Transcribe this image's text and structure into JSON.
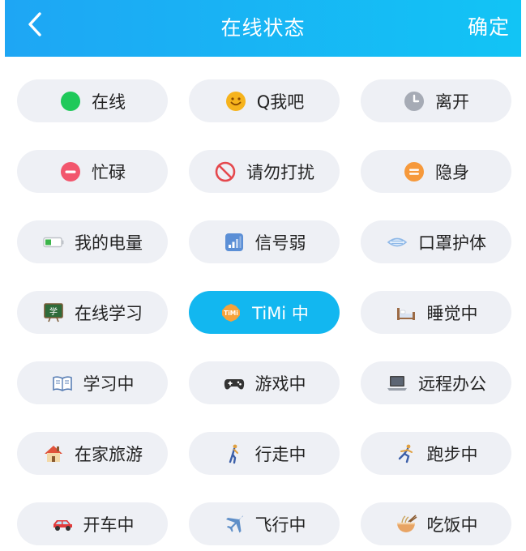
{
  "header": {
    "title": "在线状态",
    "confirm_label": "确定"
  },
  "statuses": [
    {
      "label": "在线",
      "icon": "online-dot-icon",
      "color": "#1fc95a"
    },
    {
      "label": "Q我吧",
      "icon": "smile-face-icon",
      "color": "#f6b31c"
    },
    {
      "label": "离开",
      "icon": "clock-icon",
      "color": "#a6abb5"
    },
    {
      "label": "忙碌",
      "icon": "busy-minus-icon",
      "color": "#f2566d"
    },
    {
      "label": "请勿打扰",
      "icon": "no-entry-icon",
      "color": "#e5484d"
    },
    {
      "label": "隐身",
      "icon": "invisible-icon",
      "color": "#f6993b"
    },
    {
      "label": "我的电量",
      "icon": "battery-icon",
      "color": "#3bb44a"
    },
    {
      "label": "信号弱",
      "icon": "signal-icon",
      "color": "#5b8fd6"
    },
    {
      "label": "口罩护体",
      "icon": "mask-icon",
      "color": "#8fb9e8"
    },
    {
      "label": "在线学习",
      "icon": "blackboard-icon",
      "color": "#2e6b3a"
    },
    {
      "label": "TiMi 中",
      "icon": "timi-icon",
      "color": "#f6a23a",
      "selected": true
    },
    {
      "label": "睡觉中",
      "icon": "bed-icon",
      "color": "#9c6b45"
    },
    {
      "label": "学习中",
      "icon": "book-icon",
      "color": "#5a7fb5"
    },
    {
      "label": "游戏中",
      "icon": "gamepad-icon",
      "color": "#333333"
    },
    {
      "label": "远程办公",
      "icon": "laptop-icon",
      "color": "#444444"
    },
    {
      "label": "在家旅游",
      "icon": "house-icon",
      "color": "#e0533b"
    },
    {
      "label": "行走中",
      "icon": "walking-icon",
      "color": "#e0a040"
    },
    {
      "label": "跑步中",
      "icon": "running-icon",
      "color": "#e0a040"
    },
    {
      "label": "开车中",
      "icon": "car-icon",
      "color": "#e23b3b"
    },
    {
      "label": "飞行中",
      "icon": "airplane-icon",
      "color": "#5f8fc8"
    },
    {
      "label": "吃饭中",
      "icon": "noodle-bowl-icon",
      "color": "#e8a464"
    }
  ]
}
